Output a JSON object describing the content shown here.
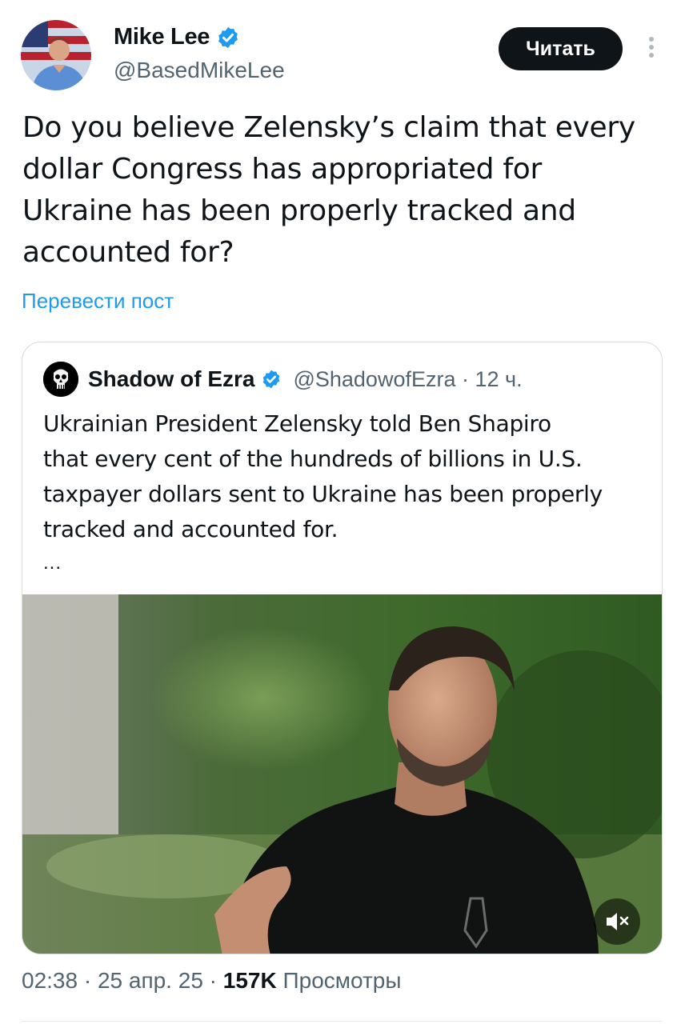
{
  "author": {
    "name": "Mike Lee",
    "handle": "@BasedMikeLee",
    "follow_label": "Читать"
  },
  "post": {
    "lines": [
      "Do you believe Zelensky’s claim that every",
      "dollar Congress has appropriated for",
      "Ukraine has been properly tracked and",
      "accounted for?"
    ],
    "translate_label": "Перевести пост"
  },
  "quote": {
    "name": "Shadow of Ezra",
    "handle_time": "@ShadowofEzra · 12 ч.",
    "lines": [
      "Ukrainian President Zelensky told Ben Shapiro",
      "that every cent of the hundreds of billions in U.S.",
      "taxpayer dollars sent to Ukraine has been properly",
      "tracked and accounted for."
    ],
    "ellipsis": "...",
    "media_icons": [
      "volume-muted-icon"
    ]
  },
  "meta": {
    "time_date": "02:38 · 25 апр. 25 · ",
    "views_count": "157K",
    "views_label": " Просмотры"
  },
  "colors": {
    "link": "#1d9bf0",
    "verified": "#1d9bf0",
    "secondary_text": "#536471",
    "follow_button_bg": "#0f1419"
  }
}
